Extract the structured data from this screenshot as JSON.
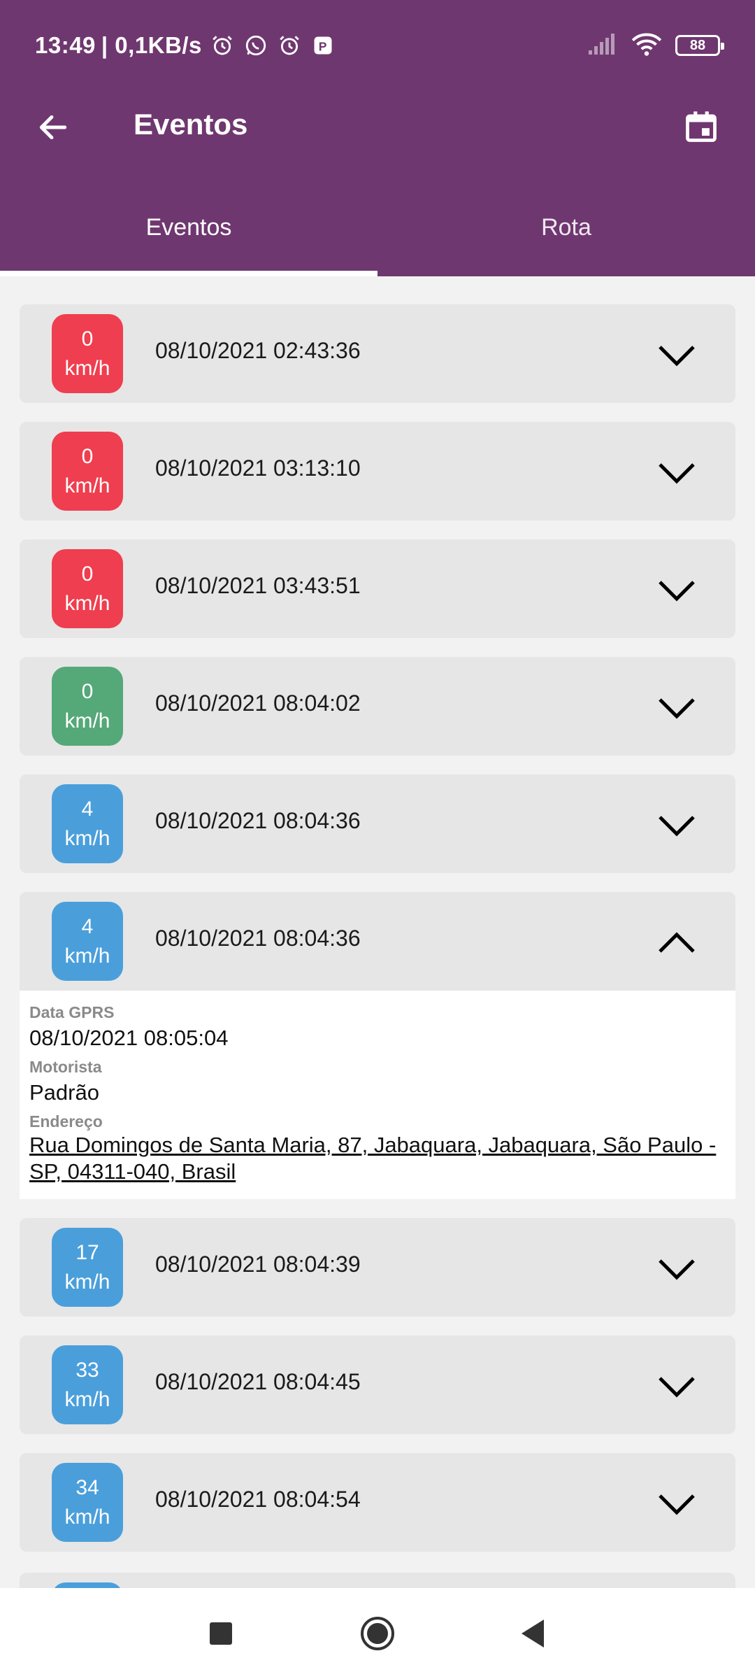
{
  "status_bar": {
    "time": "13:49",
    "network_speed": "| 0,1KB/s",
    "battery": "88",
    "icons": [
      "alarm-icon",
      "whatsapp-icon",
      "alarm-icon",
      "app-notification-icon",
      "signal-icon",
      "wifi-icon",
      "battery-icon"
    ]
  },
  "toolbar": {
    "title": "Eventos",
    "back_icon": "arrow-back-icon",
    "calendar_icon": "calendar-icon"
  },
  "tabs": [
    {
      "label": "Eventos",
      "active": true
    },
    {
      "label": "Rota",
      "active": false
    }
  ],
  "events": [
    {
      "speed": "0",
      "unit": "km/h",
      "color": "red",
      "datetime": "08/10/2021 02:43:36",
      "expanded": false
    },
    {
      "speed": "0",
      "unit": "km/h",
      "color": "red",
      "datetime": "08/10/2021 03:13:10",
      "expanded": false
    },
    {
      "speed": "0",
      "unit": "km/h",
      "color": "red",
      "datetime": "08/10/2021 03:43:51",
      "expanded": false
    },
    {
      "speed": "0",
      "unit": "km/h",
      "color": "green",
      "datetime": "08/10/2021 08:04:02",
      "expanded": false
    },
    {
      "speed": "4",
      "unit": "km/h",
      "color": "blue",
      "datetime": "08/10/2021 08:04:36",
      "expanded": false
    },
    {
      "speed": "4",
      "unit": "km/h",
      "color": "blue",
      "datetime": "08/10/2021 08:04:36",
      "expanded": true,
      "details": {
        "gprs_label": "Data GPRS",
        "gprs_value": "08/10/2021 08:05:04",
        "driver_label": "Motorista",
        "driver_value": "Padrão",
        "address_label": "Endereço",
        "address_value": "Rua Domingos de Santa Maria, 87, Jabaquara, Jabaquara, São Paulo - SP, 04311-040, Brasil"
      }
    },
    {
      "speed": "17",
      "unit": "km/h",
      "color": "blue",
      "datetime": "08/10/2021 08:04:39",
      "expanded": false
    },
    {
      "speed": "33",
      "unit": "km/h",
      "color": "blue",
      "datetime": "08/10/2021 08:04:45",
      "expanded": false
    },
    {
      "speed": "34",
      "unit": "km/h",
      "color": "blue",
      "datetime": "08/10/2021 08:04:54",
      "expanded": false
    }
  ],
  "colors": {
    "primary": "#6f376f",
    "red": "#ef3e4f",
    "green": "#55a878",
    "blue": "#4a9fdb"
  },
  "nav_bar": [
    "recents-square-icon",
    "home-circle-icon",
    "back-triangle-icon"
  ]
}
